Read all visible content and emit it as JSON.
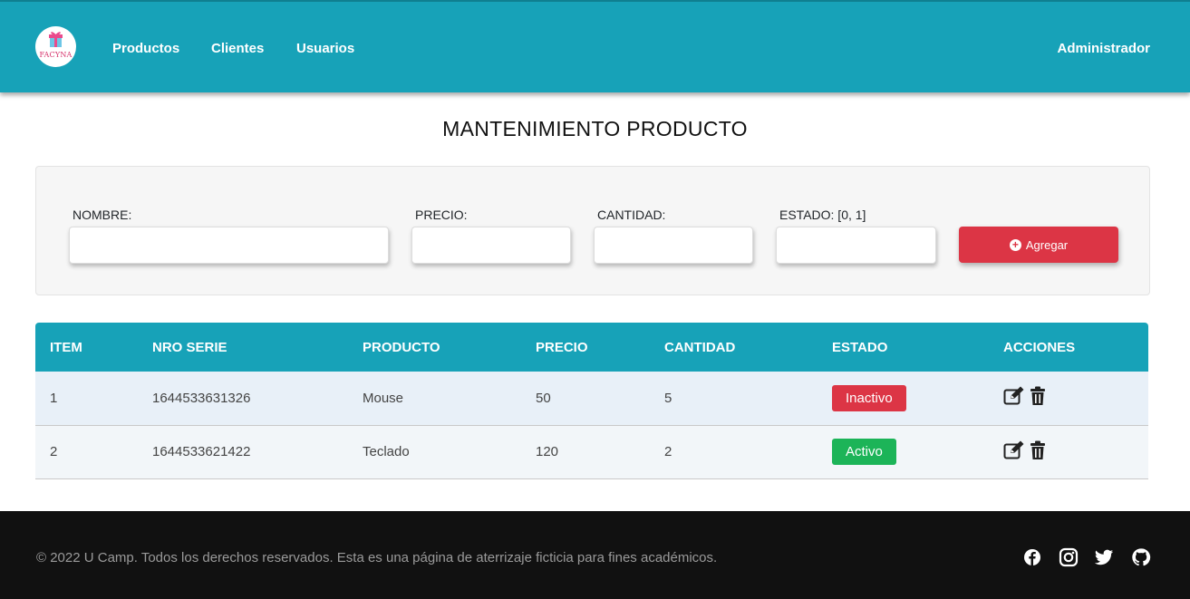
{
  "navbar": {
    "logo_text": "FACYNA",
    "links": [
      "Productos",
      "Clientes",
      "Usuarios"
    ],
    "user": "Administrador"
  },
  "page": {
    "title": "MANTENIMIENTO PRODUCTO"
  },
  "form": {
    "nombre_label": "NOMBRE:",
    "precio_label": "PRECIO:",
    "cantidad_label": "CANTIDAD:",
    "estado_label": "ESTADO: [0, 1]",
    "nombre_value": "",
    "precio_value": "",
    "cantidad_value": "",
    "estado_value": "",
    "add_button": "Agregar"
  },
  "table": {
    "headers": [
      "ITEM",
      "NRO SERIE",
      "PRODUCTO",
      "PRECIO",
      "CANTIDAD",
      "ESTADO",
      "ACCIONES"
    ],
    "rows": [
      {
        "item": "1",
        "serie": "1644533631326",
        "producto": "Mouse",
        "precio": "50",
        "cantidad": "5",
        "estado": "Inactivo"
      },
      {
        "item": "2",
        "serie": "1644533621422",
        "producto": "Teclado",
        "precio": "120",
        "cantidad": "2",
        "estado": "Activo"
      }
    ]
  },
  "footer": {
    "text": "© 2022 U Camp. Todos los derechos reservados. Esta es una página de aterrizaje ficticia para fines académicos.",
    "social_icons": [
      "facebook-icon",
      "instagram-icon",
      "twitter-icon",
      "github-icon"
    ]
  },
  "colors": {
    "primary": "#17a2b8",
    "danger": "#dc3545",
    "success": "#1cb458",
    "footer": "#111111"
  }
}
